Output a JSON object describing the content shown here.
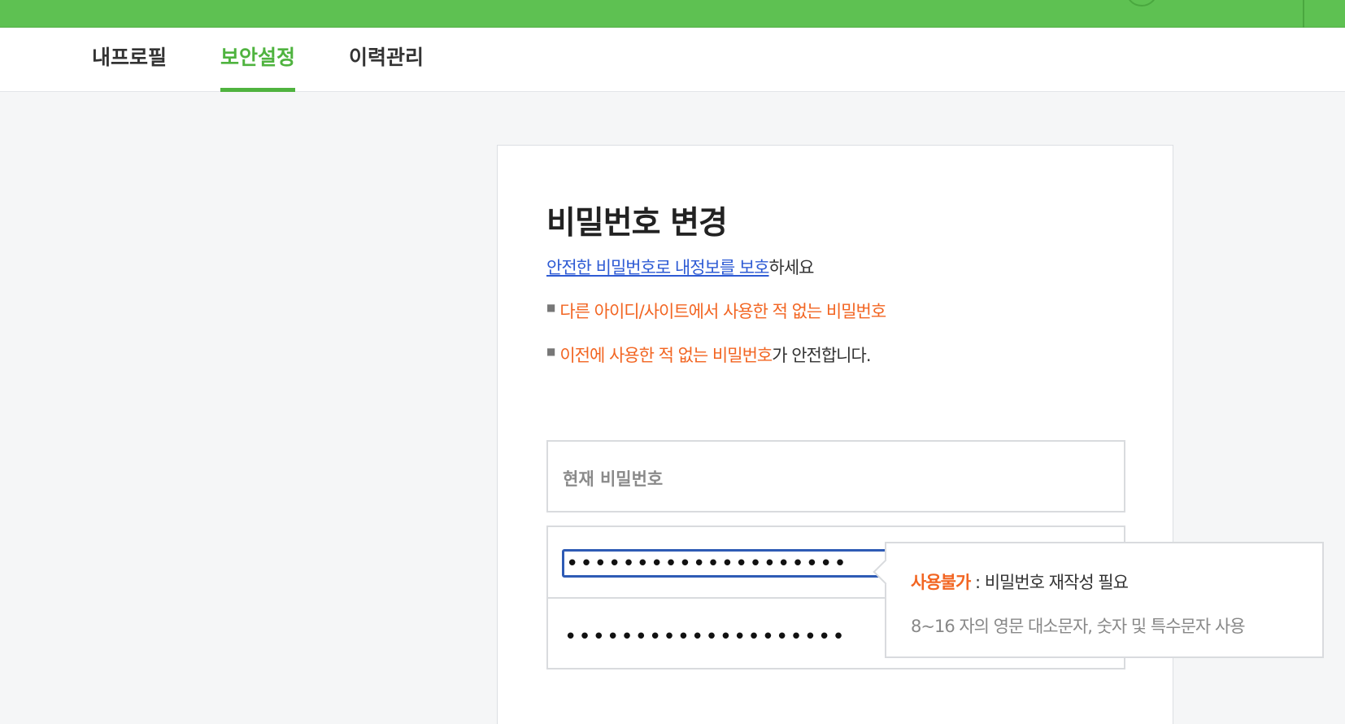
{
  "tabs": [
    {
      "label": "내프로필"
    },
    {
      "label": "보안설정"
    },
    {
      "label": "이력관리"
    }
  ],
  "active_tab": "보안설정",
  "card": {
    "title": "비밀번호 변경",
    "subtitle_link": "안전한 비밀번호로 내정보를 보호",
    "subtitle_suffix": "하세요",
    "tip1": "다른 아이디/사이트에서 사용한 적 없는 비밀번호",
    "tip2_highlight": "이전에 사용한 적 없는 비밀번호",
    "tip2_suffix": "가 안전합니다.",
    "current_password_placeholder": "현재 비밀번호",
    "new_password_value": "••••••••••••••••••••",
    "confirm_password_value": "••••••••••••••••••••"
  },
  "tooltip": {
    "status": "사용불가",
    "separator": " : ",
    "message": "비밀번호 재작성 필요",
    "rule": "8~16 자의 영문 대소문자, 숫자 및 특수문자 사용"
  },
  "colors": {
    "brand_green": "#5ec152",
    "active_tab": "#4fb33f",
    "link_blue": "#2e5bd4",
    "warning_orange": "#f26522",
    "focus_border": "#2e5bb5"
  }
}
